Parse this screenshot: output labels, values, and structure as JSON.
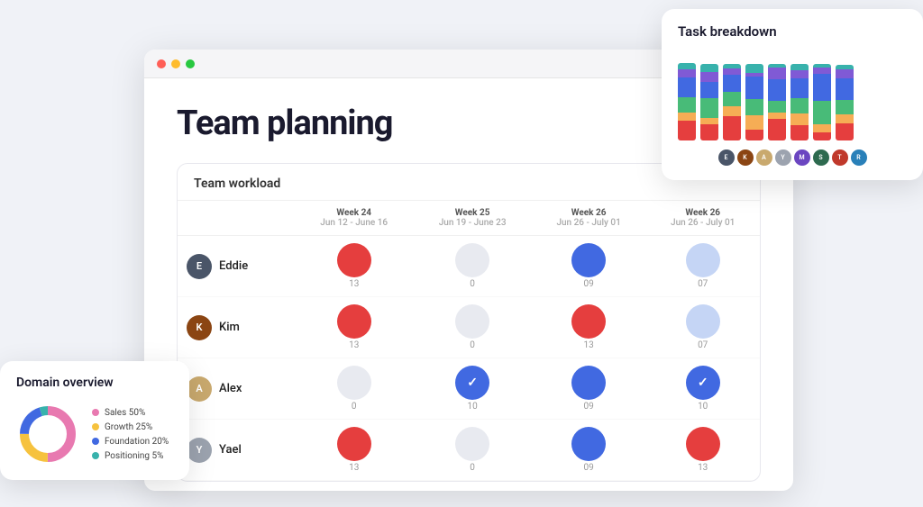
{
  "page": {
    "title": "Team planning",
    "bg": "#f0f2f7"
  },
  "browser": {
    "dots": [
      "#ff5f57",
      "#febc2e",
      "#28c840"
    ]
  },
  "workload": {
    "heading": "Team workload",
    "weeks": [
      {
        "label": "Week 24",
        "sub": "Jun 12 - June 16"
      },
      {
        "label": "Week 25",
        "sub": "Jun 19 - June 23"
      },
      {
        "label": "Week 26",
        "sub": "Jun 26 - July 01"
      },
      {
        "label": "Week 26",
        "sub": "Jun 26 - July 01"
      }
    ],
    "rows": [
      {
        "name": "Eddie",
        "avatar_bg": "#4a5568",
        "initials": "E",
        "tasks": [
          {
            "type": "red",
            "count": "13"
          },
          {
            "type": "light-gray",
            "count": "0"
          },
          {
            "type": "blue",
            "count": "09"
          },
          {
            "type": "light-blue",
            "count": "07"
          }
        ]
      },
      {
        "name": "Kim",
        "avatar_bg": "#8b4513",
        "initials": "K",
        "tasks": [
          {
            "type": "red",
            "count": "13"
          },
          {
            "type": "light-gray",
            "count": "0"
          },
          {
            "type": "red",
            "count": "13"
          },
          {
            "type": "light-blue",
            "count": "07"
          }
        ]
      },
      {
        "name": "Alex",
        "avatar_bg": "#c9a96e",
        "initials": "A",
        "tasks": [
          {
            "type": "light-gray",
            "count": "0"
          },
          {
            "type": "blue-check",
            "count": "10"
          },
          {
            "type": "blue",
            "count": "09"
          },
          {
            "type": "blue-check",
            "count": "10"
          }
        ]
      },
      {
        "name": "Yael",
        "avatar_bg": "#9ca3af",
        "initials": "Y",
        "tasks": [
          {
            "type": "red",
            "count": "13"
          },
          {
            "type": "light-gray",
            "count": "0"
          },
          {
            "type": "blue",
            "count": "09"
          },
          {
            "type": "red",
            "count": "13"
          }
        ]
      }
    ]
  },
  "domain": {
    "title": "Domain overview",
    "segments": [
      {
        "label": "Sales 50%",
        "color": "#e879b0",
        "percent": 50
      },
      {
        "label": "Growth 25%",
        "color": "#f6c23e",
        "percent": 25
      },
      {
        "label": "Foundation 20%",
        "color": "#4169e1",
        "percent": 20
      },
      {
        "label": "Positioning 5%",
        "color": "#38b2ac",
        "percent": 5
      }
    ]
  },
  "breakdown": {
    "title": "Task breakdown",
    "bars": [
      {
        "red": 25,
        "orange": 10,
        "green": 20,
        "blue": 25,
        "purple": 10,
        "teal": 8
      },
      {
        "red": 20,
        "orange": 8,
        "green": 25,
        "blue": 20,
        "purple": 12,
        "teal": 10
      },
      {
        "red": 30,
        "orange": 12,
        "green": 18,
        "blue": 22,
        "purple": 8,
        "teal": 6
      },
      {
        "red": 15,
        "orange": 20,
        "green": 22,
        "blue": 30,
        "purple": 5,
        "teal": 12
      },
      {
        "red": 28,
        "orange": 8,
        "green": 15,
        "blue": 28,
        "purple": 15,
        "teal": 5
      },
      {
        "red": 20,
        "orange": 15,
        "green": 20,
        "blue": 25,
        "purple": 10,
        "teal": 8
      },
      {
        "red": 10,
        "orange": 10,
        "green": 30,
        "blue": 35,
        "purple": 8,
        "teal": 5
      },
      {
        "red": 22,
        "orange": 12,
        "green": 18,
        "blue": 28,
        "purple": 12,
        "teal": 6
      }
    ],
    "avatars": [
      {
        "initials": "E",
        "bg": "#4a5568"
      },
      {
        "initials": "K",
        "bg": "#8b4513"
      },
      {
        "initials": "A",
        "bg": "#c9a96e"
      },
      {
        "initials": "Y",
        "bg": "#9ca3af"
      },
      {
        "initials": "M",
        "bg": "#6b46c1"
      },
      {
        "initials": "S",
        "bg": "#2d6a4f"
      },
      {
        "initials": "T",
        "bg": "#c0392b"
      },
      {
        "initials": "R",
        "bg": "#2980b9"
      }
    ]
  }
}
